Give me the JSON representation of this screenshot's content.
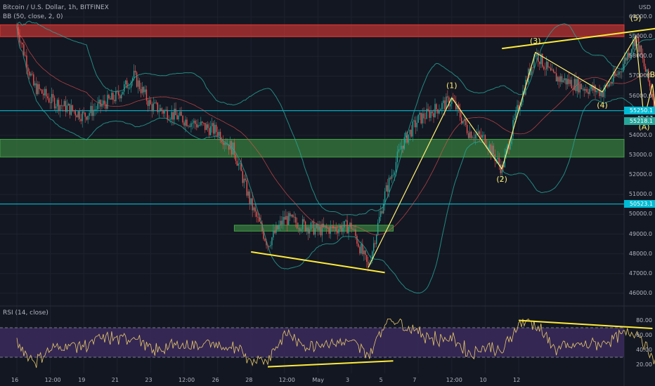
{
  "header": {
    "symbol": "Bitcoin / U.S. Dollar, 1h, BITFINEX",
    "indicator_bb": "BB (50, close, 2, 0)",
    "indicator_rsi": "RSI (14, close)",
    "currency": "USD"
  },
  "price_axis": {
    "ticks": [
      "60000.0",
      "59000.0",
      "58000.0",
      "57000.0",
      "56000.0",
      "54000.0",
      "53000.0",
      "52000.0",
      "51000.0",
      "50000.0",
      "49000.0",
      "48000.0",
      "47000.0",
      "46000.0"
    ],
    "badges": [
      {
        "label": "55250.1",
        "color": "#00bcd4"
      },
      {
        "label": "49:57",
        "color": "#131722"
      },
      {
        "label": "55218.1",
        "color": "#26a69a"
      },
      {
        "label": "50523.1",
        "color": "#00bcd4"
      }
    ]
  },
  "rsi_axis": {
    "ticks": [
      "80.00",
      "60.00",
      "40.00",
      "20.00"
    ]
  },
  "time_axis": {
    "labels": [
      "16",
      "12:00",
      "19",
      "21",
      "23",
      "12:00",
      "26",
      "28",
      "12:00",
      "May",
      "3",
      "5",
      "7",
      "12:00",
      "10",
      "12"
    ]
  },
  "chart_data": {
    "type": "candlestick",
    "title": "Bitcoin / U.S. Dollar, 1h, BITFINEX",
    "ylim": [
      45500,
      60500
    ],
    "zones": [
      {
        "name": "resistance",
        "from": 59000,
        "to": 59600,
        "color": "#e53935"
      },
      {
        "name": "support",
        "from": 52900,
        "to": 53800,
        "color": "#43a047"
      },
      {
        "name": "minor-support",
        "from": 49150,
        "to": 49450,
        "color": "#43a047"
      }
    ],
    "horizontal_lines": [
      55250,
      50523
    ],
    "wave_labels": [
      {
        "label": "(1)",
        "time": "Apr 29 00:00",
        "price": 56400
      },
      {
        "label": "(2)",
        "time": "Apr 30 12:00",
        "price": 51650
      },
      {
        "label": "(3)",
        "time": "May 1 12:00",
        "price": 58650
      },
      {
        "label": "(4)",
        "time": "May 3 12:00",
        "price": 55400
      },
      {
        "label": "(5)",
        "time": "May 4 12:00",
        "price": 59800
      },
      {
        "label": "(A)",
        "time": "May 4 18:00",
        "price": 54300
      },
      {
        "label": "(B)",
        "time": "May 5 00:00",
        "price": 56950
      },
      {
        "label": "(C)",
        "time": "May 5 06:00",
        "price": 52200
      }
    ],
    "wave_path": [
      [
        "Apr 26 12:00",
        47300
      ],
      [
        "Apr 29 00:00",
        55900
      ],
      [
        "Apr 30 12:00",
        52300
      ],
      [
        "May 1 12:00",
        58200
      ],
      [
        "May 3 12:00",
        56200
      ],
      [
        "May 4 12:00",
        59000
      ],
      [
        "May 4 18:00",
        54800
      ],
      [
        "May 5 00:00",
        56600
      ],
      [
        "May 5 06:00",
        52900
      ]
    ],
    "trend_lines": [
      {
        "from": [
          "Apr 23 00:00",
          48100
        ],
        "to": [
          "Apr 27 00:00",
          47050
        ]
      },
      {
        "from": [
          "Apr 30 12:00",
          58400
        ],
        "to": [
          "May 5 12:00",
          59500
        ]
      },
      {
        "from": [
          "May 5 12:00",
          55700
        ],
        "to": [
          "May 6 00:00",
          56000
        ]
      }
    ],
    "rsi_trend_lines": [
      {
        "from": [
          "Apr 23 12:00",
          17
        ],
        "to": [
          "Apr 27 06:00",
          25
        ]
      },
      {
        "from": [
          "May 1 00:00",
          80
        ],
        "to": [
          "May 5 00:00",
          69
        ]
      }
    ],
    "rsi_levels": [
      70,
      30
    ],
    "rsi_ylim": [
      10,
      90
    ]
  },
  "colors": {
    "bg": "#131722",
    "up": "#26a69a",
    "down": "#ef5350",
    "wave": "#fff176",
    "trend": "#ffeb3b",
    "rsi": "#e8c96c",
    "rsi_band": "#3b2a5c"
  }
}
